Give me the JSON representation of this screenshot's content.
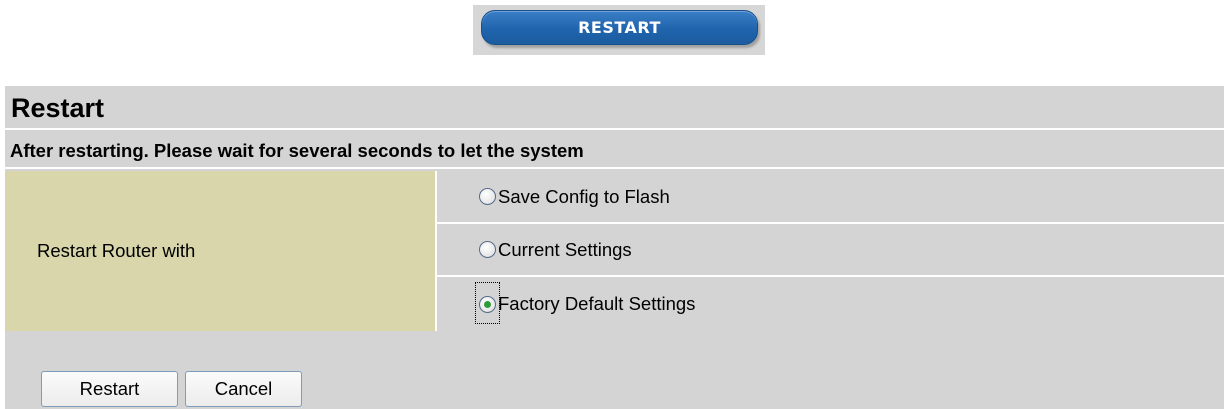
{
  "top_tab": {
    "label": "RESTART"
  },
  "panel": {
    "title": "Restart",
    "subtitle": "After restarting. Please wait for several seconds to let the system"
  },
  "form": {
    "label": "Restart Router with",
    "options": [
      {
        "label": "Save Config to Flash",
        "checked": false
      },
      {
        "label": "Current Settings",
        "checked": false
      },
      {
        "label": "Factory Default Settings",
        "checked": true
      }
    ]
  },
  "buttons": {
    "restart_label": "Restart",
    "cancel_label": "Cancel"
  },
  "colors": {
    "tab_blue": "#1f64ad",
    "panel_gray": "#d4d4d4",
    "label_cell_khaki": "#d8d6aa",
    "radio_checked": "#2f9a3a"
  }
}
